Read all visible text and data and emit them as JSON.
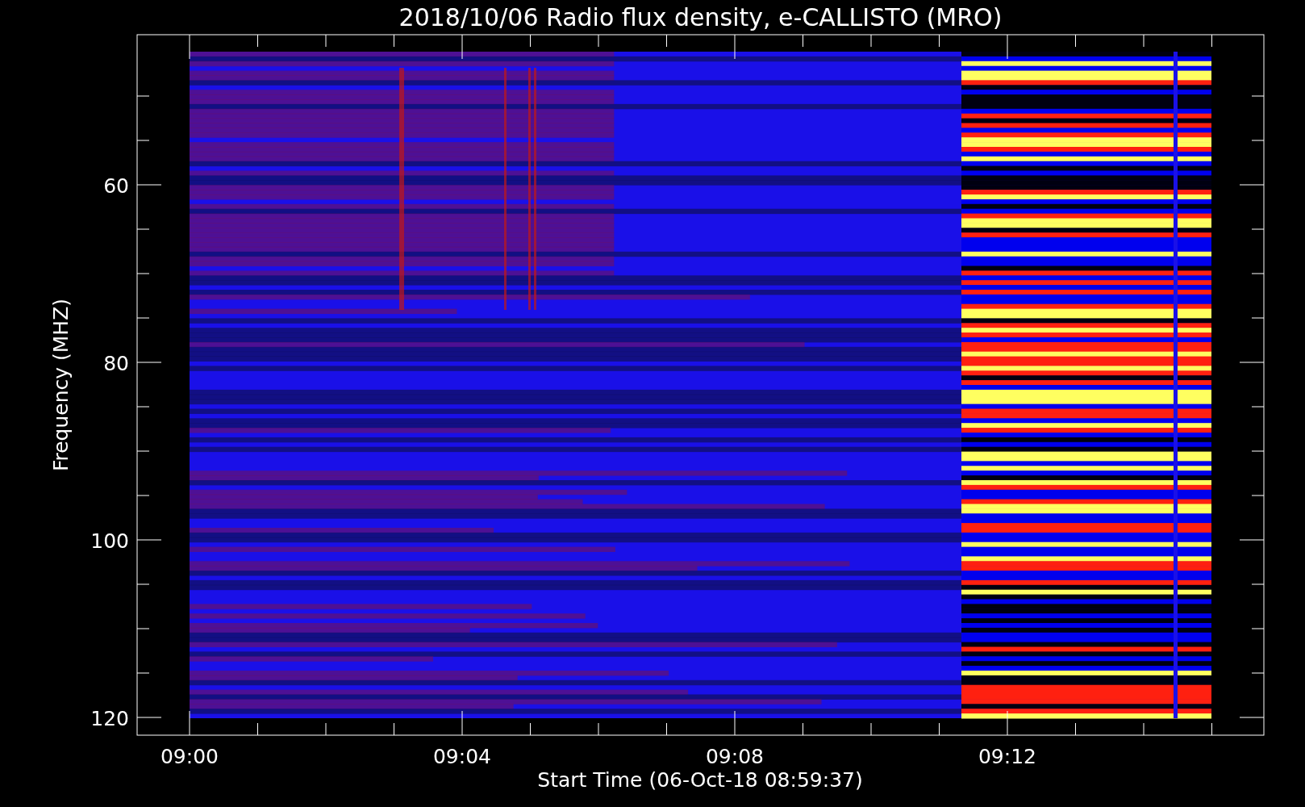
{
  "plot": {
    "title": "2018/10/06  Radio flux density, e-CALLISTO (MRO)",
    "xlabel": "Start Time (06-Oct-18 08:59:37)",
    "ylabel": "Frequency (MHZ)",
    "xticks": [
      "09:00",
      "09:04",
      "09:08",
      "09:12"
    ],
    "yticks": [
      "60",
      "80",
      "100",
      "120"
    ]
  }
}
